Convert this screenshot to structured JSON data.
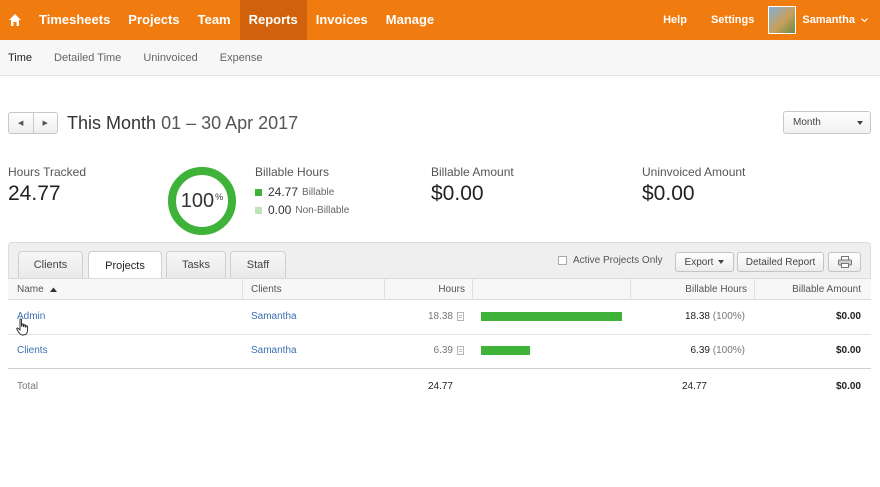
{
  "topnav": {
    "items": [
      "Timesheets",
      "Projects",
      "Team",
      "Reports",
      "Invoices",
      "Manage"
    ],
    "active": "Reports",
    "help": "Help",
    "settings": "Settings",
    "user": "Samantha"
  },
  "subnav": {
    "items": [
      "Time",
      "Detailed Time",
      "Uninvoiced",
      "Expense"
    ],
    "active": "Time"
  },
  "period": {
    "title": "This Month",
    "range": "01 – 30 Apr 2017",
    "select": "Month"
  },
  "stats": {
    "hours_tracked_label": "Hours Tracked",
    "hours_tracked_value": "24.77",
    "donut_value": "100",
    "donut_unit": "%",
    "billable_hours_label": "Billable Hours",
    "billable_value": "24.77",
    "billable_text": "Billable",
    "nonbillable_value": "0.00",
    "nonbillable_text": "Non-Billable",
    "billable_amount_label": "Billable Amount",
    "billable_amount_value": "$0.00",
    "uninvoiced_amount_label": "Uninvoiced Amount",
    "uninvoiced_amount_value": "$0.00",
    "billable_fraction": 1.0
  },
  "colors": {
    "brand": "#f07b0f",
    "billable": "#3fb23a",
    "nonbillable": "#bfe2b8",
    "link": "#3a6fb0"
  },
  "tabs": [
    "Clients",
    "Projects",
    "Tasks",
    "Staff"
  ],
  "active_tab": "Projects",
  "toolbar": {
    "active_only": "Active Projects Only",
    "export": "Export",
    "detailed_report": "Detailed Report"
  },
  "table": {
    "headers": [
      "Name",
      "Clients",
      "Hours",
      "Billable Hours",
      "Billable Amount"
    ],
    "rows": [
      {
        "name": "Admin",
        "client": "Samantha",
        "hours": "18.38",
        "billable_hours": "18.38",
        "billable_pct": "(100%)",
        "amount": "$0.00",
        "bar_fraction": 0.742
      },
      {
        "name": "Clients",
        "client": "Samantha",
        "hours": "6.39",
        "billable_hours": "6.39",
        "billable_pct": "(100%)",
        "amount": "$0.00",
        "bar_fraction": 0.258
      }
    ],
    "total": {
      "label": "Total",
      "hours": "24.77",
      "billable_hours": "24.77",
      "amount": "$0.00"
    }
  }
}
